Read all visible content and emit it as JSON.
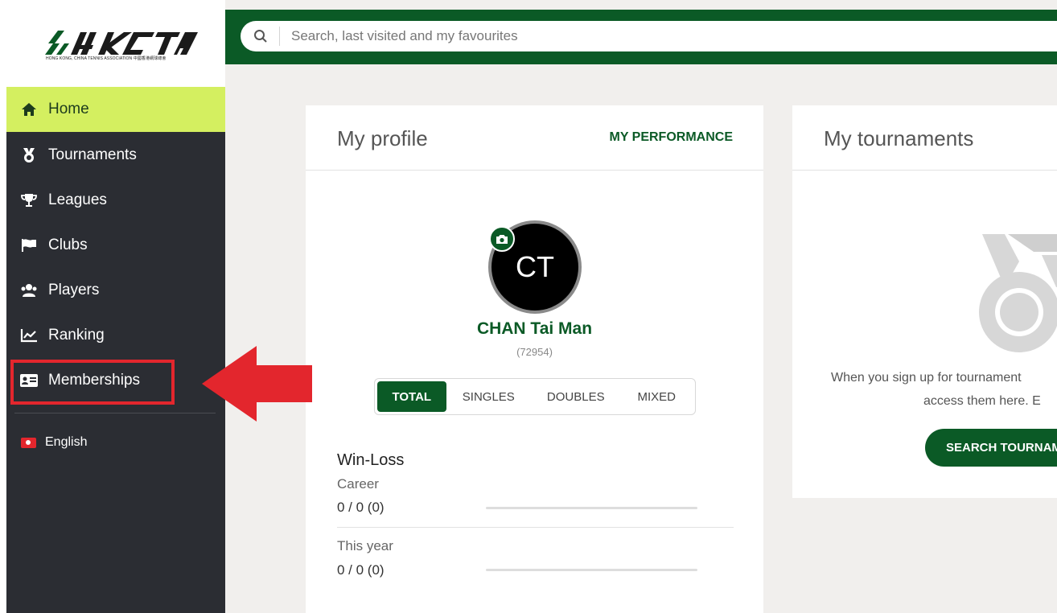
{
  "logo": {
    "text": "HKCTA",
    "subtitle": "HONG KONG, CHINA TENNIS ASSOCIATION 中國香港網球總會"
  },
  "sidebar": {
    "items": [
      {
        "label": "Home",
        "icon": "home-icon"
      },
      {
        "label": "Tournaments",
        "icon": "medal-icon"
      },
      {
        "label": "Leagues",
        "icon": "trophy-icon"
      },
      {
        "label": "Clubs",
        "icon": "flag-icon"
      },
      {
        "label": "Players",
        "icon": "players-icon"
      },
      {
        "label": "Ranking",
        "icon": "chart-icon"
      },
      {
        "label": "Memberships",
        "icon": "id-card-icon"
      }
    ],
    "language": "English"
  },
  "search": {
    "placeholder": "Search, last visited and my favourites"
  },
  "profile": {
    "title": "My profile",
    "performance_link": "MY PERFORMANCE",
    "initials": "CT",
    "name": "CHAN Tai Man",
    "player_id": "(72954)",
    "tabs": [
      "TOTAL",
      "SINGLES",
      "DOUBLES",
      "MIXED"
    ],
    "winloss": {
      "title": "Win-Loss",
      "career_label": "Career",
      "career_value": "0 / 0 (0)",
      "year_label": "This year",
      "year_value": "0 / 0 (0)"
    }
  },
  "tournaments": {
    "title": "My tournaments",
    "message_line1": "When you sign up for tournament",
    "message_line2": "access them here. E",
    "button": "SEARCH TOURNAM"
  },
  "colors": {
    "brand_green": "#0b5a26",
    "active_nav": "#d4ef60",
    "sidebar_bg": "#2b2d33",
    "highlight_red": "#e3262d"
  }
}
